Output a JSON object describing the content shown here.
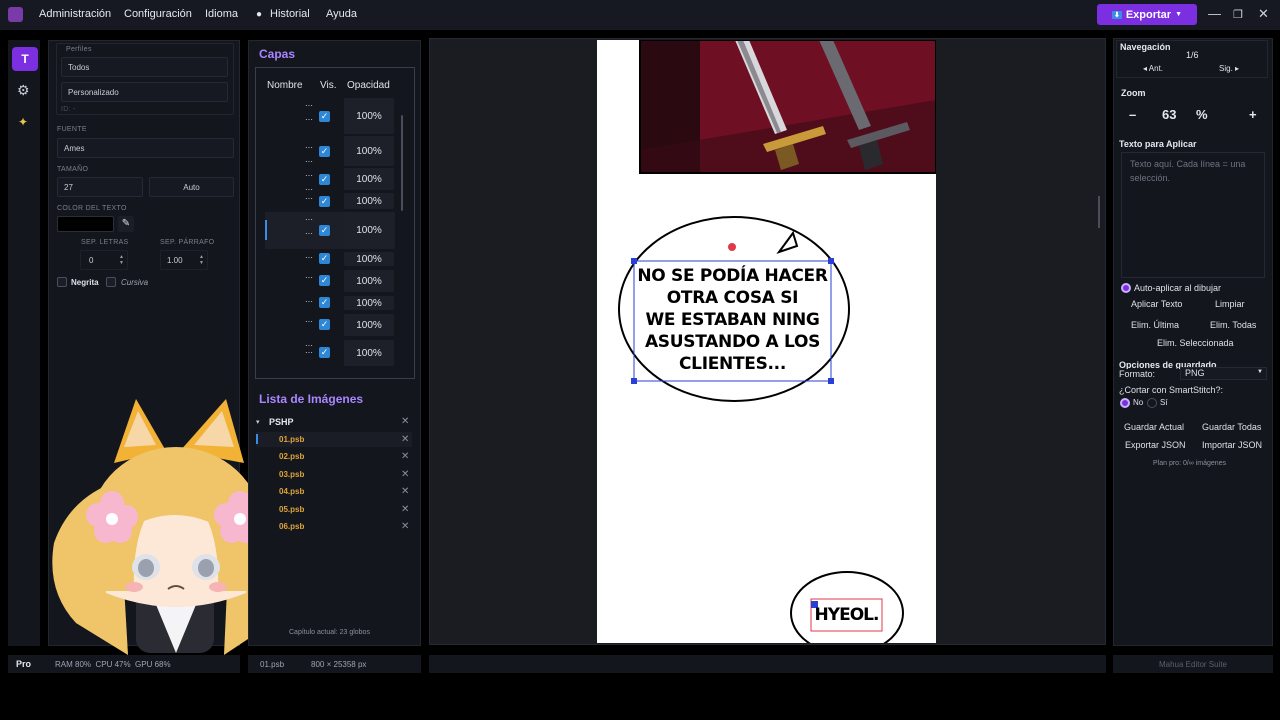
{
  "menu": {
    "items": [
      "Administración",
      "Configuración",
      "Idioma",
      "Historial",
      "Ayuda"
    ],
    "export_label": "Exportar"
  },
  "left_panel": {
    "profiles_label": "Perfiles",
    "profile_all": "Todos",
    "profile_custom": "Personalizado",
    "id_label": "ID: -",
    "font_label": "FUENTE",
    "font_value": "Ames",
    "size_label": "TAMAÑO",
    "size_value": "27",
    "auto_label": "Auto",
    "color_label": "COLOR DEL TEXTO",
    "letter_spacing_label": "SEP. LETRAS",
    "letter_spacing_value": "0",
    "paragraph_spacing_label": "SEP. PÁRRAFO",
    "paragraph_spacing_value": "1.00",
    "bold_label": "Negrita",
    "italic_label": "Cursiva"
  },
  "layers": {
    "title": "Capas",
    "col_name": "Nombre",
    "col_vis": "Vis.",
    "col_opacity": "Opacidad",
    "opacity": [
      "100%",
      "100%",
      "100%",
      "100%",
      "100%",
      "100%",
      "100%",
      "100%",
      "100%",
      "100%"
    ]
  },
  "images": {
    "title": "Lista de Imágenes",
    "folder": "PSHP",
    "files": [
      "01.psb",
      "02.psb",
      "03.psb",
      "04.psb",
      "05.psb",
      "06.psb"
    ],
    "chapter_status": "Capítulo actual: 23 globos"
  },
  "canvas": {
    "bubble_text": [
      "NO SE PODÍA HACER",
      "OTRA COSA SI",
      "WE ESTABAN NING",
      "ASUSTANDO A LOS",
      "CLIENTES..."
    ],
    "small_bubble_text": "HYEOL."
  },
  "right_panel": {
    "nav_label": "Navegación",
    "page_indicator": "1/6",
    "prev_label": "◂ Ant.",
    "next_label": "Sig. ▸",
    "zoom_label": "Zoom",
    "zoom_minus": "–",
    "zoom_value": "63",
    "zoom_unit": "%",
    "zoom_plus": "+",
    "text_apply_label": "Texto para Aplicar",
    "text_placeholder": "Texto aquí. Cada línea = una selección.",
    "auto_apply_label": "Auto-aplicar al dibujar",
    "apply_text": "Aplicar Texto",
    "clear": "Limpiar",
    "del_last": "Elim. Última",
    "del_all": "Elim. Todas",
    "del_selected": "Elim. Seleccionada",
    "save_options_label": "Opciones de guardado",
    "format_label": "Formato:",
    "format_value": "PNG",
    "smartstitch_label": "¿Cortar con SmartStitch?:",
    "opt_no": "No",
    "opt_yes": "Sí",
    "save_current": "Guardar Actual",
    "save_all": "Guardar Todas",
    "export_json": "Exportar JSON",
    "import_json": "Importar JSON",
    "plan_info": "Plan pro: 0/∞ imágenes"
  },
  "status": {
    "pro": "Pro",
    "resources": "RAM 80%  CPU 47%  GPU 68%",
    "file": "01.psb",
    "dimensions": "800 × 25358 px",
    "app_name": "Mahua Editor Suite"
  },
  "colors": {
    "accent": "#7b2fe0",
    "check": "#2e87d6",
    "file_name": "#e0a43a"
  }
}
